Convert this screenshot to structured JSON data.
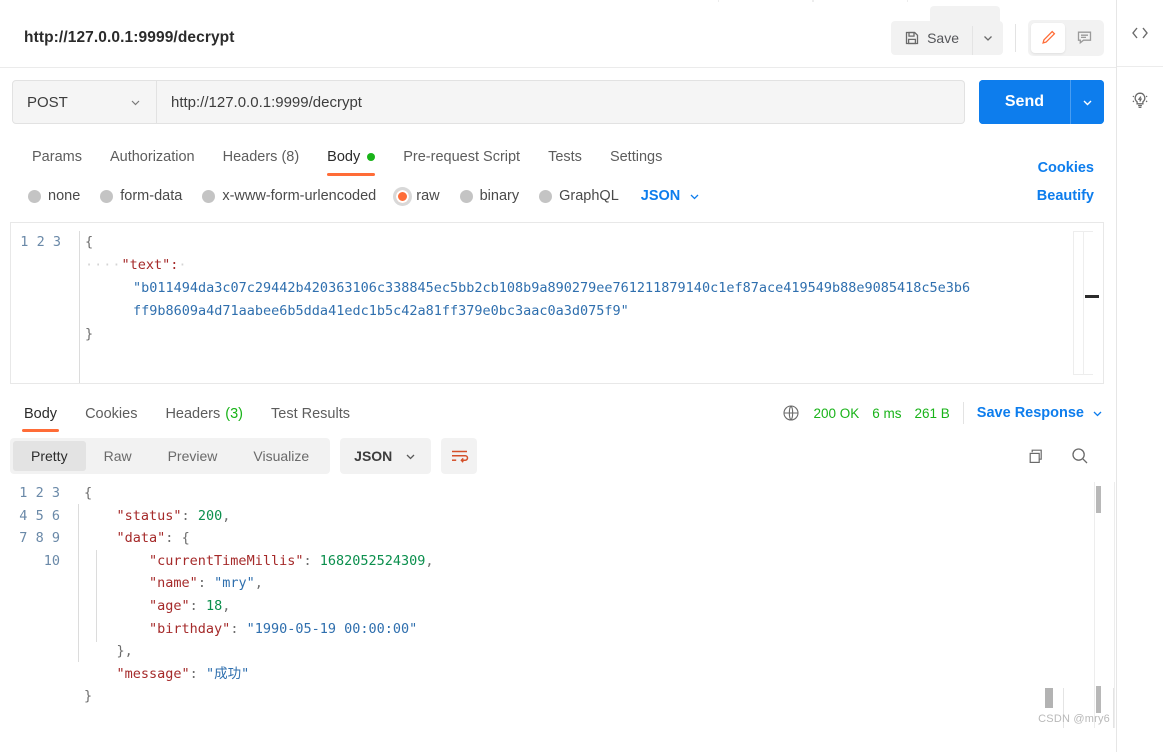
{
  "request": {
    "title": "http://127.0.0.1:9999/decrypt",
    "method": "POST",
    "url": "http://127.0.0.1:9999/decrypt",
    "save_label": "Save",
    "send_label": "Send",
    "tabs": [
      {
        "label": "Params",
        "active": false
      },
      {
        "label": "Authorization",
        "active": false
      },
      {
        "label": "Headers (8)",
        "active": false
      },
      {
        "label": "Body",
        "active": true
      },
      {
        "label": "Pre-request Script",
        "active": false
      },
      {
        "label": "Tests",
        "active": false
      },
      {
        "label": "Settings",
        "active": false
      }
    ],
    "cookies_link": "Cookies",
    "body_types": [
      {
        "label": "none",
        "selected": false
      },
      {
        "label": "form-data",
        "selected": false
      },
      {
        "label": "x-www-form-urlencoded",
        "selected": false
      },
      {
        "label": "raw",
        "selected": true
      },
      {
        "label": "binary",
        "selected": false
      },
      {
        "label": "GraphQL",
        "selected": false
      }
    ],
    "format": "JSON",
    "beautify_label": "Beautify",
    "body_lines": [
      "1",
      "2",
      "3"
    ],
    "body_open_brace": "{",
    "body_indent_dots": "····",
    "body_key": "\"text\":",
    "body_value_line1": "\"b011494da3c07c29442b420363106c338845ec5bb2cb108b9a890279ee761211879140c1ef87ace419549b88e9085418c5e3b6",
    "body_value_line2": "ff9b8609a4d71aabee6b5dda41edc1b5c42a81ff379e0bc3aac0a3d075f9\"",
    "body_close_brace": "}"
  },
  "response": {
    "tabs": [
      {
        "label": "Body",
        "count": "",
        "active": true
      },
      {
        "label": "Cookies",
        "count": "",
        "active": false
      },
      {
        "label": "Headers",
        "count": "(3)",
        "active": false
      },
      {
        "label": "Test Results",
        "count": "",
        "active": false
      }
    ],
    "status": "200 OK",
    "time": "6 ms",
    "size": "261 B",
    "save_response_label": "Save Response",
    "view_modes": [
      {
        "label": "Pretty",
        "active": true
      },
      {
        "label": "Raw",
        "active": false
      },
      {
        "label": "Preview",
        "active": false
      },
      {
        "label": "Visualize",
        "active": false
      }
    ],
    "format": "JSON",
    "line_numbers": [
      "1",
      "2",
      "3",
      "4",
      "5",
      "6",
      "7",
      "8",
      "9",
      "10"
    ],
    "json": {
      "l1": "{",
      "l2_key": "\"status\"",
      "l2_val": "200",
      "l2_comma": ",",
      "l3_key": "\"data\"",
      "l3_brace": "{",
      "l4_key": "\"currentTimeMillis\"",
      "l4_val": "1682052524309",
      "l4_comma": ",",
      "l5_key": "\"name\"",
      "l5_val": "\"mry\"",
      "l5_comma": ",",
      "l6_key": "\"age\"",
      "l6_val": "18",
      "l6_comma": ",",
      "l7_key": "\"birthday\"",
      "l7_val": "\"1990-05-19 00:00:00\"",
      "l8": "},",
      "l9_key": "\"message\"",
      "l9_val": "\"成功\"",
      "l10": "}"
    }
  },
  "watermark": "CSDN @mry6",
  "colors": {
    "accent_orange": "#ff6c37",
    "link_blue": "#0d7ded",
    "status_green": "#19b319",
    "json_key": "#a52a2a",
    "json_string": "#2f6fae",
    "json_number": "#0b8f4d"
  }
}
